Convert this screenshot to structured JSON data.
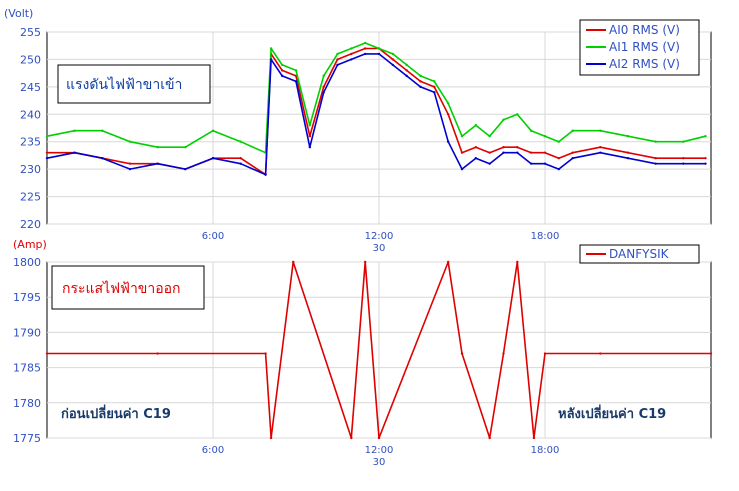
{
  "chart_data": [
    {
      "type": "line",
      "unit_label": "(Volt)",
      "annotation": "แรงดันไฟฟ้าขาเข้า",
      "ylim": [
        220,
        255
      ],
      "yticks": [
        220,
        225,
        230,
        235,
        240,
        245,
        250,
        255
      ],
      "xlim": [
        0,
        24
      ],
      "xticks": [
        {
          "value": 6,
          "label": "6:00"
        },
        {
          "value": 12,
          "label": "12:00",
          "sublabel": "30"
        },
        {
          "value": 18,
          "label": "18:00"
        }
      ],
      "grid": true,
      "legend_position": "top-right",
      "x": [
        0,
        1,
        2,
        3,
        4,
        5,
        6,
        7,
        7.9,
        8.1,
        8.5,
        9,
        9.5,
        10,
        10.5,
        11,
        11.5,
        12,
        12.5,
        13,
        13.5,
        14,
        14.5,
        15,
        15.5,
        16,
        16.5,
        17,
        17.5,
        18,
        18.5,
        19,
        20,
        21,
        22,
        23,
        23.8
      ],
      "series": [
        {
          "name": "AI0 RMS (V)",
          "color": "#e00000",
          "values": [
            233,
            233,
            232,
            231,
            231,
            230,
            232,
            232,
            229,
            251,
            248,
            247,
            236,
            245,
            250,
            251,
            252,
            252,
            250,
            248,
            246,
            245,
            240,
            233,
            234,
            233,
            234,
            234,
            233,
            233,
            232,
            233,
            234,
            233,
            232,
            232,
            232
          ]
        },
        {
          "name": "AI1 RMS (V)",
          "color": "#00d000",
          "values": [
            236,
            237,
            237,
            235,
            234,
            234,
            237,
            235,
            233,
            252,
            249,
            248,
            238,
            247,
            251,
            252,
            253,
            252,
            251,
            249,
            247,
            246,
            242,
            236,
            238,
            236,
            239,
            240,
            237,
            236,
            235,
            237,
            237,
            236,
            235,
            235,
            236
          ]
        },
        {
          "name": "AI2 RMS (V)",
          "color": "#0000d0",
          "values": [
            232,
            233,
            232,
            230,
            231,
            230,
            232,
            231,
            229,
            250,
            247,
            246,
            234,
            244,
            249,
            250,
            251,
            251,
            249,
            247,
            245,
            244,
            235,
            230,
            232,
            231,
            233,
            233,
            231,
            231,
            230,
            232,
            233,
            232,
            231,
            231,
            231
          ]
        }
      ]
    },
    {
      "type": "line",
      "unit_label": "(Amp)",
      "annotation": "กระแสไฟฟ้าขาออก",
      "note_left": "ก่อนเปลี่ยนค่า C19",
      "note_right": "หลังเปลี่ยนค่า C19",
      "ylim": [
        1775,
        1800
      ],
      "yticks": [
        1775,
        1780,
        1785,
        1790,
        1795,
        1800
      ],
      "xlim": [
        0,
        24
      ],
      "xticks": [
        {
          "value": 6,
          "label": "6:00"
        },
        {
          "value": 12,
          "label": "12:00",
          "sublabel": "30"
        },
        {
          "value": 18,
          "label": "18:00"
        }
      ],
      "grid": true,
      "legend_position": "top-right",
      "x": [
        0,
        4,
        7.9,
        8.1,
        8.9,
        11,
        11.5,
        12,
        14.5,
        15,
        16,
        16.5,
        17,
        17.6,
        18,
        20,
        24
      ],
      "series": [
        {
          "name": "DANFYSIK",
          "color": "#e00000",
          "values": [
            1787,
            1787,
            1787,
            1775,
            1800,
            1775,
            1800,
            1775,
            1800,
            1787,
            1775,
            1787,
            1800,
            1775,
            1787,
            1787,
            1787
          ]
        }
      ]
    }
  ]
}
